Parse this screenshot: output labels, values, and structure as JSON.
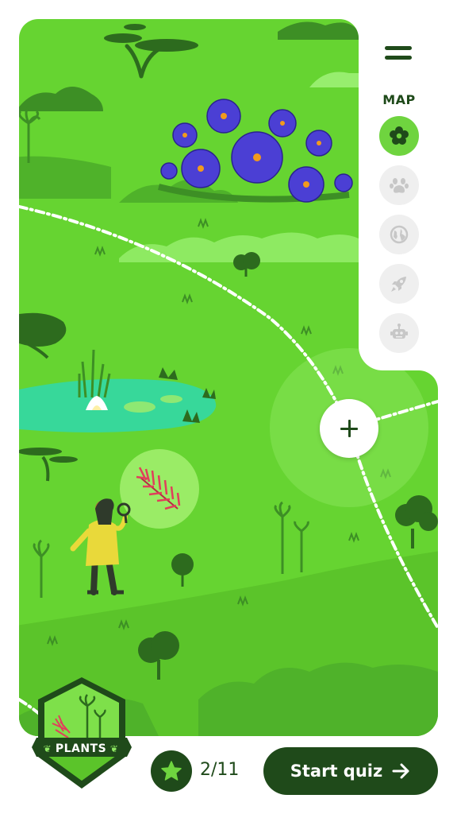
{
  "sidebar": {
    "map_label": "MAP",
    "categories": [
      {
        "icon": "flower-icon",
        "active": true
      },
      {
        "icon": "paw-icon",
        "active": false
      },
      {
        "icon": "globe-icon",
        "active": false
      },
      {
        "icon": "rocket-icon",
        "active": false
      },
      {
        "icon": "robot-icon",
        "active": false
      }
    ]
  },
  "badge": {
    "label": "PLANTS"
  },
  "progress": {
    "text": "2/11",
    "completed": 2,
    "total": 11
  },
  "quiz_button": {
    "label": "Start quiz",
    "icon": "arrow-right-icon"
  },
  "colors": {
    "map_green": "#66d431",
    "dark_green": "#1f4a1a",
    "accent_green": "#6fd43f",
    "water": "#37d89a",
    "flower_blue": "#5040d6",
    "inactive_icon": "#c7c7c7"
  }
}
